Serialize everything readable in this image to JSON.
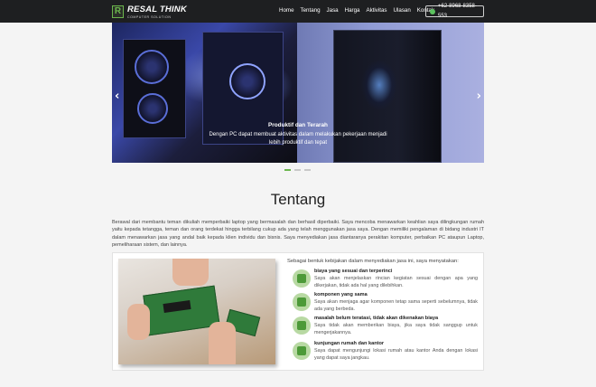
{
  "brand": {
    "mark": "R",
    "name": "RESAL THINK",
    "sub": "COMPUTER SOLUTION"
  },
  "nav": {
    "items": [
      "Home",
      "Tentang",
      "Jasa",
      "Harga",
      "Aktivitas",
      "Ulasan",
      "Kontak"
    ]
  },
  "phone": "+62-8968-8358-553",
  "carousel": {
    "caption_title": "Produktif dan Terarah",
    "caption_text": "Dengan PC dapat membuat aktivitas dalam melakukan pekerjaan menjadi lebih produktif dan tepat",
    "prev": "‹",
    "next": "›",
    "active_index": 0,
    "slide_count": 3
  },
  "about": {
    "title": "Tentang",
    "text": "Berawal dari membantu teman dikuliah memperbaiki laptop yang bermasalah dan berhasil diperbaiki. Saya mencoba menawarkan keahlian saya dilingkungan rumah yaitu kepada tetangga, teman dan orang terdekat hingga terbilang cukup ada yang telah menggunakan jasa saya. Dengan memiliki pengalaman di bidang industri IT dalam menawarkan jasa yang andal baik kepada klien individu dan bisnis. Saya menyediakan jasa diantaranya perakitan komputer, perbaikan PC ataupun Laptop, pemeliharaan sistem, dan lainnya.",
    "intro": "Sebagai bentuk kebijakan dalam menyediakan jasa ini, saya menyatakan:",
    "features": [
      {
        "icon": "handshake-icon",
        "title": "biaya yang sesuai dan terperinci",
        "desc": "Saya akan menjelaskan rincian kegiatan sesuai dengan apa yang dikerjakan, tidak ada hal yang dilebihkan."
      },
      {
        "icon": "check-icon",
        "title": "komponen yang sama",
        "desc": "Saya akan menjaga agar komponen tetap sama seperti sebelumnya, tidak ada yang berbeda."
      },
      {
        "icon": "money-icon",
        "title": "masalah belum teratasi, tidak akan dikenakan biaya",
        "desc": "Saya tidak akan memberikan biaya, jika saya tidak sanggup untuk mengerjakannya."
      },
      {
        "icon": "building-icon",
        "title": "kunjungan rumah dan kantor",
        "desc": "Saya dapat mengunjungi lokasi rumah atau kantor Anda dengan lokasi yang dapat saya jangkau."
      }
    ]
  },
  "colors": {
    "navbar": "#1e1f21",
    "accent": "#6bb64d",
    "icon_bg": "#b8d9a3"
  }
}
